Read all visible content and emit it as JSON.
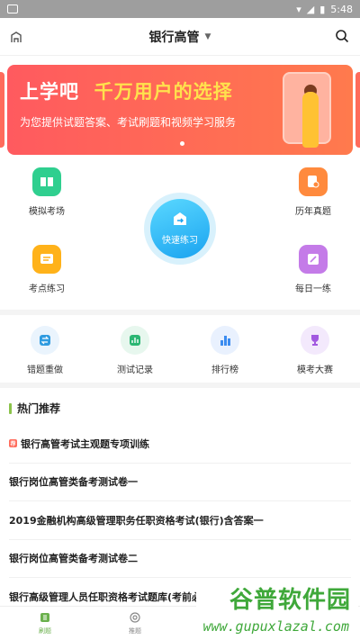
{
  "status": {
    "time": "5:48"
  },
  "nav": {
    "title": "银行高管"
  },
  "banner": {
    "headline_a": "上学吧",
    "headline_b": "千万用户的选择",
    "subtitle": "为您提供试题答案、考试刷题和视频学习服务"
  },
  "quick": {
    "mock_exam": "模拟考场",
    "past_papers": "历年真题",
    "topic_practice": "考点练习",
    "daily": "每日一练",
    "fast_practice": "快速练习"
  },
  "tools": [
    {
      "label": "错题重做",
      "icon": "redo-icon",
      "color": "#2f9be0"
    },
    {
      "label": "测试记录",
      "icon": "chart-icon",
      "color": "#2bb673"
    },
    {
      "label": "排行榜",
      "icon": "bar-ranking-icon",
      "color": "#3b8cf0"
    },
    {
      "label": "模考大赛",
      "icon": "trophy-icon",
      "color": "#a259e0"
    }
  ],
  "hot": {
    "title": "热门推荐",
    "items": [
      "银行高管考试主观题专项训练",
      "银行岗位高管类备考测试卷一",
      "2019金融机构高级管理职务任职资格考试(银行)含答案一",
      "银行岗位高管类备考测试卷二",
      "银行高级管理人员任职资格考试题库(考前必做)5"
    ]
  },
  "tabbar": {
    "tab1": "刷题",
    "tab2": "推题"
  },
  "watermark": {
    "top": "谷普软件园",
    "bottom": "www.gupuxlazal.com"
  },
  "colors": {
    "accent": "#6ab04c",
    "banner": "#ff5a5f"
  }
}
